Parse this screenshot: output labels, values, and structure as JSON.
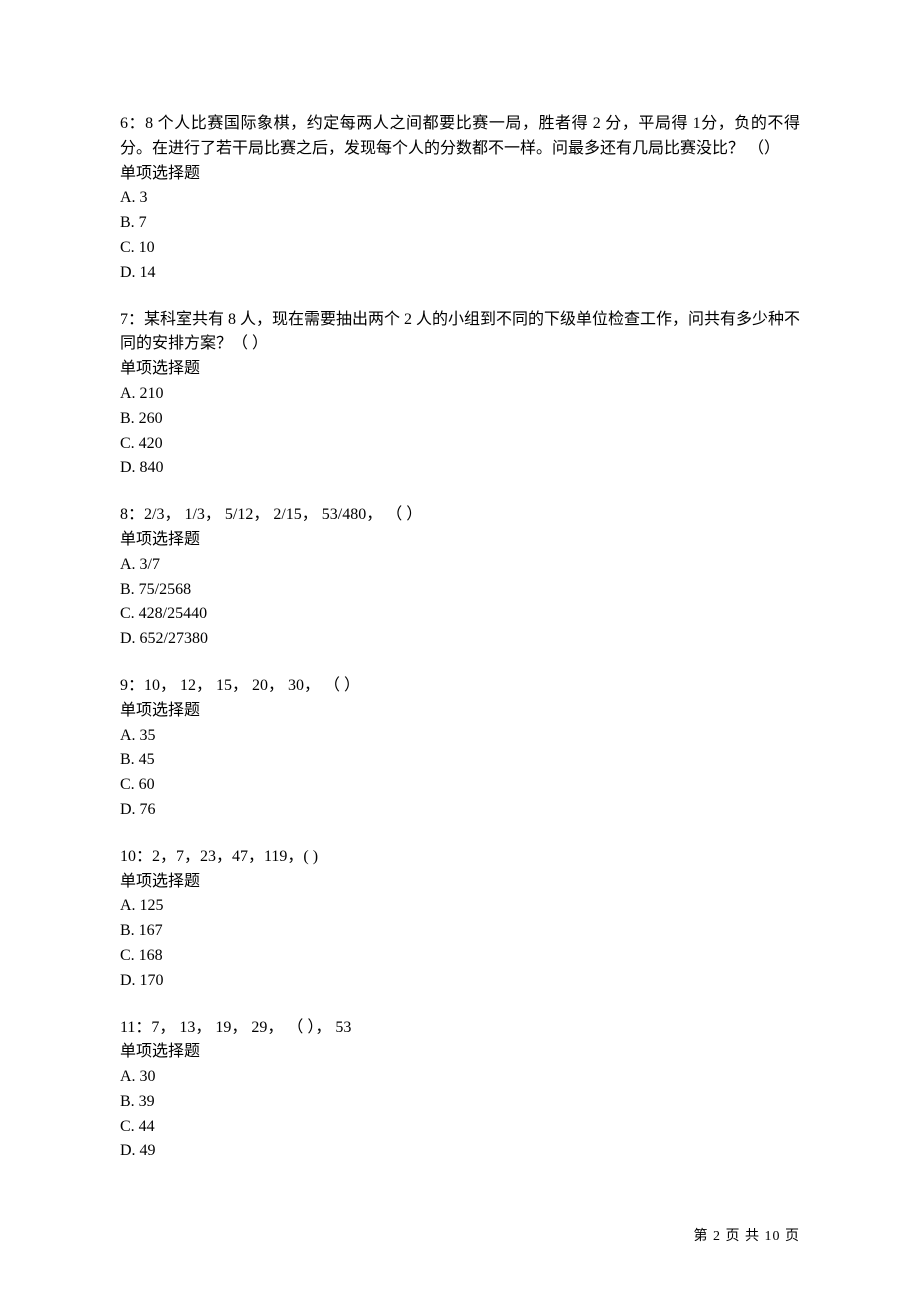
{
  "questions": [
    {
      "num": "6",
      "text": "6：8 个人比赛国际象棋，约定每两人之间都要比赛一局，胜者得 2 分，平局得 1分，负的不得分。在进行了若干局比赛之后，发现每个人的分数都不一样。问最多还有几局比赛没比？ （）",
      "type": "单项选择题",
      "options": [
        "A. 3",
        "B. 7",
        "C. 10",
        "D. 14"
      ]
    },
    {
      "num": "7",
      "text": "7：某科室共有 8 人，现在需要抽出两个 2 人的小组到不同的下级单位检查工作，问共有多少种不同的安排方案？（  ）",
      "type": "单项选择题",
      "options": [
        "A. 210",
        "B. 260",
        "C. 420",
        "D. 840"
      ]
    },
    {
      "num": "8",
      "text": "8：2/3， 1/3， 5/12， 2/15， 53/480， （  ）",
      "type": "单项选择题",
      "options": [
        "A. 3/7",
        "B. 75/2568",
        "C. 428/25440",
        "D. 652/27380"
      ]
    },
    {
      "num": "9",
      "text": "9：10， 12， 15， 20， 30， （  ）",
      "type": "单项选择题",
      "options": [
        "A. 35",
        "B. 45",
        "C. 60",
        "D. 76"
      ]
    },
    {
      "num": "10",
      "text": "10：2，7，23，47，119，(  )",
      "type": "单项选择题",
      "options": [
        "A. 125",
        "B. 167",
        "C. 168",
        "D. 170"
      ]
    },
    {
      "num": "11",
      "text": "11：7， 13， 19， 29， （  ）， 53",
      "type": "单项选择题",
      "options": [
        "A. 30",
        "B. 39",
        "C. 44",
        "D. 49"
      ]
    }
  ],
  "footer": "第 2 页 共 10 页"
}
